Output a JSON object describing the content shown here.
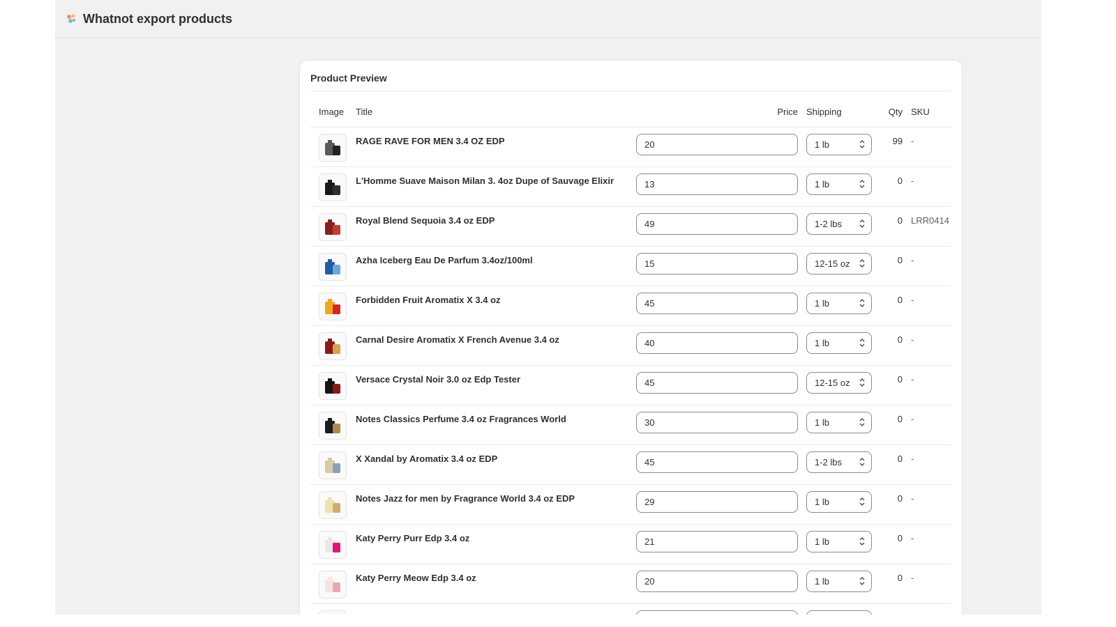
{
  "app": {
    "title": "Whatnot export products"
  },
  "card": {
    "title": "Product Preview"
  },
  "columns": {
    "image": "Image",
    "title": "Title",
    "price": "Price",
    "shipping": "Shipping",
    "qty": "Qty",
    "sku": "SKU"
  },
  "rows": [
    {
      "title": "RAGE RAVE FOR MEN 3.4 OZ EDP",
      "price": "20",
      "shipping": "1 lb",
      "qty": "99",
      "sku": "-",
      "thumb": [
        "#5a5a5a",
        "#222222"
      ]
    },
    {
      "title": "L'Homme Suave Maison Milan 3. 4oz Dupe of Sauvage Elixir",
      "price": "13",
      "shipping": "1 lb",
      "qty": "0",
      "sku": "-",
      "thumb": [
        "#1a1a1a",
        "#3a2a2a"
      ]
    },
    {
      "title": "Royal Blend Sequoia 3.4 oz EDP",
      "price": "49",
      "shipping": "1-2 lbs",
      "qty": "0",
      "sku": "LRR0414",
      "thumb": [
        "#8b1e1e",
        "#c43c2c"
      ]
    },
    {
      "title": "Azha Iceberg Eau De Parfum 3.4oz/100ml",
      "price": "15",
      "shipping": "12-15 oz",
      "qty": "0",
      "sku": "-",
      "thumb": [
        "#1f5fa8",
        "#6aa7dd"
      ]
    },
    {
      "title": "Forbidden Fruit Aromatix X 3.4 oz",
      "price": "45",
      "shipping": "1 lb",
      "qty": "0",
      "sku": "-",
      "thumb": [
        "#f2a51c",
        "#d9261c"
      ]
    },
    {
      "title": "Carnal Desire Aromatix X French Avenue 3.4 oz",
      "price": "40",
      "shipping": "1 lb",
      "qty": "0",
      "sku": "-",
      "thumb": [
        "#8a1a1a",
        "#d7a24a"
      ]
    },
    {
      "title": "Versace Crystal Noir 3.0 oz Edp Tester",
      "price": "45",
      "shipping": "12-15 oz",
      "qty": "0",
      "sku": "-",
      "thumb": [
        "#141414",
        "#8b1a1a"
      ]
    },
    {
      "title": "Notes Classics Perfume 3.4 oz Fragrances World",
      "price": "30",
      "shipping": "1 lb",
      "qty": "0",
      "sku": "-",
      "thumb": [
        "#1c1c1c",
        "#b08a4a"
      ]
    },
    {
      "title": "X Xandal by Aromatix 3.4 oz EDP",
      "price": "45",
      "shipping": "1-2 lbs",
      "qty": "0",
      "sku": "-",
      "thumb": [
        "#d8c9a8",
        "#8aa0b8"
      ]
    },
    {
      "title": "Notes Jazz for men by Fragrance World 3.4 oz EDP",
      "price": "29",
      "shipping": "1 lb",
      "qty": "0",
      "sku": "-",
      "thumb": [
        "#efe0b0",
        "#cfae6a"
      ]
    },
    {
      "title": "Katy Perry Purr Edp 3.4 oz",
      "price": "21",
      "shipping": "1 lb",
      "qty": "0",
      "sku": "-",
      "thumb": [
        "#e8e8e8",
        "#e4147a"
      ]
    },
    {
      "title": "Katy Perry Meow Edp 3.4 oz",
      "price": "20",
      "shipping": "1 lb",
      "qty": "0",
      "sku": "-",
      "thumb": [
        "#f6e4e4",
        "#e8a8b0"
      ]
    },
    {
      "title": "",
      "price": "",
      "shipping": "",
      "qty": "",
      "sku": "",
      "thumb": [
        "#fafafa",
        "#fafafa"
      ]
    }
  ],
  "colors": {
    "border_input": "#8a8a8a",
    "card_bg": "#ffffff",
    "page_bg": "#f1f1f1"
  }
}
